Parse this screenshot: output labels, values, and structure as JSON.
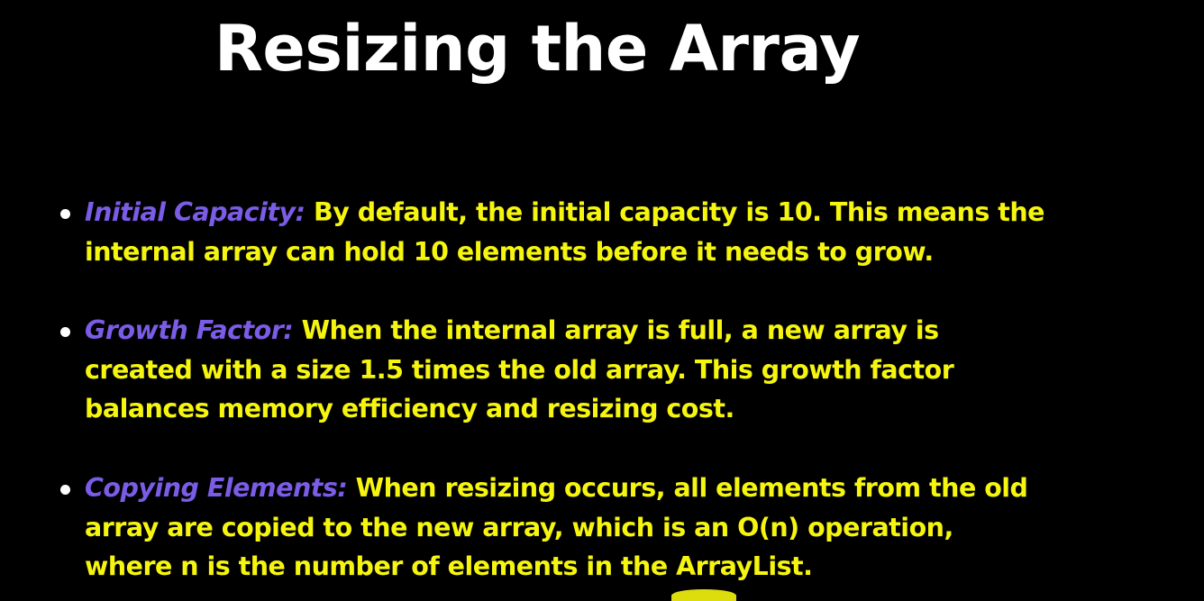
{
  "slide": {
    "title": "Resizing the Array",
    "bullets": [
      {
        "label": "Initial Capacity:",
        "text": "By default, the initial capacity is 10. This means the internal array can hold 10 elements before it needs to grow."
      },
      {
        "label": "Growth Factor:",
        "text": "When the internal array is full, a new array is created with a size 1.5 times the old array. This growth factor balances memory efficiency and resizing cost."
      },
      {
        "label": "Copying Elements:",
        "text": "When resizing occurs, all elements from the old array are copied to the new array, which is an O(n) operation, where n is the number of elements in the ArrayList."
      }
    ]
  },
  "colors": {
    "background": "#000000",
    "title": "#ffffff",
    "body_text": "#f5f50f",
    "label": "#7b5ce6",
    "bullet_dot": "#ffffff"
  }
}
